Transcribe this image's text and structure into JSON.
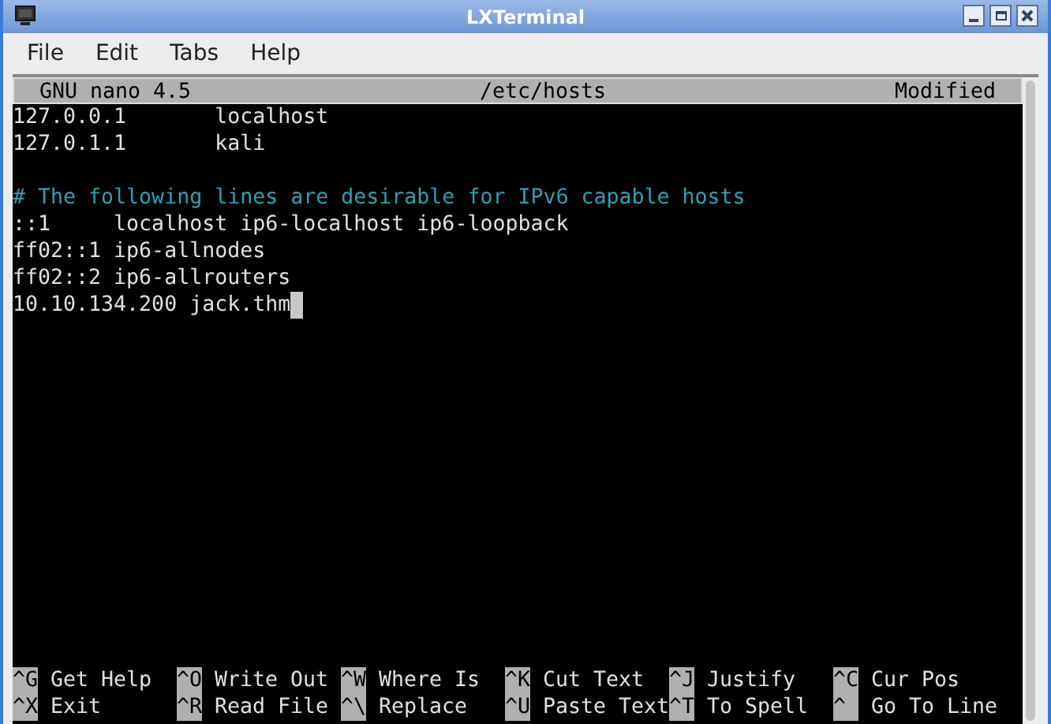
{
  "window": {
    "title": "LXTerminal"
  },
  "menu": [
    "File",
    "Edit",
    "Tabs",
    "Help"
  ],
  "nano": {
    "version": "GNU nano 4.5",
    "file": "/etc/hosts",
    "status": "Modified"
  },
  "lines": [
    {
      "kind": "text",
      "text": "127.0.0.1       localhost",
      "cursor": false
    },
    {
      "kind": "text",
      "text": "127.0.1.1       kali",
      "cursor": false
    },
    {
      "kind": "blank"
    },
    {
      "kind": "comment",
      "text": "# The following lines are desirable for IPv6 capable hosts",
      "cursor": false
    },
    {
      "kind": "text",
      "text": "::1     localhost ip6-localhost ip6-loopback",
      "cursor": false
    },
    {
      "kind": "text",
      "text": "ff02::1 ip6-allnodes",
      "cursor": false
    },
    {
      "kind": "text",
      "text": "ff02::2 ip6-allrouters",
      "cursor": false
    },
    {
      "kind": "text",
      "text": "10.10.134.200 jack.thm",
      "cursor": true
    }
  ],
  "shortcuts": [
    [
      {
        "key": "^G",
        "label": "Get Help"
      },
      {
        "key": "^O",
        "label": "Write Out"
      },
      {
        "key": "^W",
        "label": "Where Is"
      },
      {
        "key": "^K",
        "label": "Cut Text"
      },
      {
        "key": "^J",
        "label": "Justify"
      },
      {
        "key": "^C",
        "label": "Cur Pos"
      }
    ],
    [
      {
        "key": "^X",
        "label": "Exit"
      },
      {
        "key": "^R",
        "label": "Read File"
      },
      {
        "key": "^\\",
        "label": "Replace"
      },
      {
        "key": "^U",
        "label": "Paste Text"
      },
      {
        "key": "^T",
        "label": "To Spell"
      },
      {
        "key": "^",
        "label": "Go To Line"
      }
    ]
  ]
}
